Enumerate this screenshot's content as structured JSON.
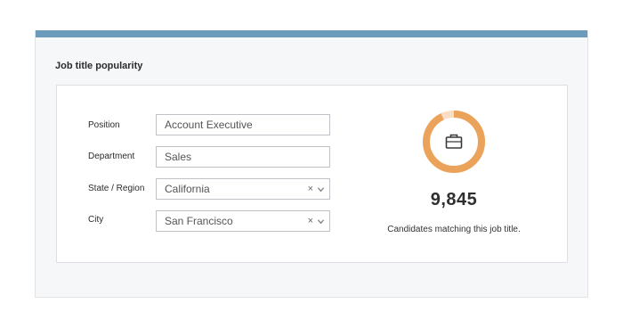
{
  "card": {
    "title": "Job title popularity"
  },
  "form": {
    "position": {
      "label": "Position",
      "value": "Account Executive"
    },
    "department": {
      "label": "Department",
      "value": "Sales"
    },
    "state": {
      "label": "State / Region",
      "value": "California",
      "clear": "×"
    },
    "city": {
      "label": "City",
      "value": "San Francisco",
      "clear": "×"
    }
  },
  "result": {
    "count": "9,845",
    "caption": "Candidates matching this job title.",
    "fill_fraction": 0.93,
    "icon": "briefcase-icon"
  },
  "colors": {
    "accent": "#6b9bbb",
    "donut_fill": "#eba25a",
    "donut_track": "#f9dec6"
  }
}
